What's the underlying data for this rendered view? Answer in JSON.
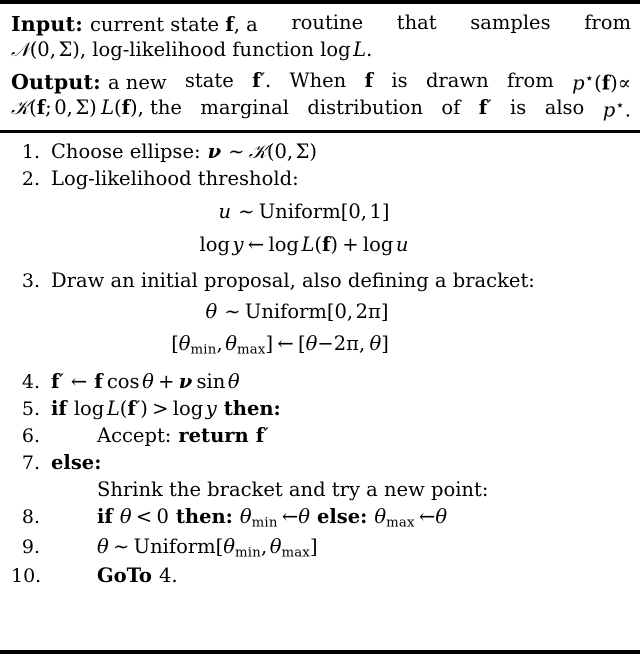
{
  "algorithm": {
    "header": {
      "input": {
        "label": "Input:",
        "line1_rest": "current state ",
        "f": "f",
        "line1_tail": ", a routine that samples from",
        "line2_a": "(0, ",
        "sigma": "Σ",
        "line2_b": "), log-likelihood function ",
        "log": "log",
        "L": "L",
        "period": "."
      },
      "output": {
        "label": "Output:",
        "t1": "a new state ",
        "fprime": "f′",
        "t2": ". When ",
        "f": "f",
        "t3": " is drawn from ",
        "p": "p",
        "star": "⋆",
        "propto": "∝",
        "t4": "(f; 0, Σ) L(f), the marginal distribution of ",
        "t5": " is also ",
        "t6": "."
      }
    },
    "steps": [
      {
        "num": "1.",
        "text": "Choose ellipse:",
        "math": "ν ∼ 𝒩(0, Σ)",
        "kind": "choose-ellipse"
      },
      {
        "num": "2.",
        "text": "Log-likelihood threshold:",
        "kind": "log-likelihood-threshold"
      },
      {
        "num": "",
        "equation": "u ∼ Uniform[0, 1]",
        "kind": "equation-u"
      },
      {
        "num": "",
        "equation": "log y ← log L(f) + log u",
        "kind": "equation-log-y"
      },
      {
        "num": "3.",
        "text": "Draw an initial proposal, also defining a bracket:",
        "kind": "draw-initial-proposal"
      },
      {
        "num": "",
        "equation": "θ ∼ Uniform[0, 2π]",
        "kind": "equation-theta"
      },
      {
        "num": "",
        "equation": "[θmin, θmax] ← [θ−2π, θ]",
        "kind": "equation-bracket"
      },
      {
        "num": "4.",
        "math": "f′ ← f cos θ + ν sin θ",
        "kind": "rotate-proposal"
      },
      {
        "num": "5.",
        "math": "if log L(f′) > log y then:",
        "kind": "if-accept-test"
      },
      {
        "num": "6.",
        "math": "Accept: return f′",
        "kind": "accept-return"
      },
      {
        "num": "7.",
        "math": "else:",
        "kind": "else-branch"
      },
      {
        "num": "",
        "text": "Shrink the bracket and try a new point:",
        "kind": "shrink-bracket-comment"
      },
      {
        "num": "8.",
        "math": "if θ < 0 then: θmin ← θ else: θmax ← θ",
        "kind": "shrink-bracket-update"
      },
      {
        "num": "9.",
        "math": "θ ∼ Uniform[θmin, θmax]",
        "kind": "resample-theta"
      },
      {
        "num": "10.",
        "math": "GoTo 4.",
        "kind": "goto-step-4"
      }
    ],
    "symbols": {
      "cal_N": "𝒩",
      "sigma": "Σ",
      "nu": "ν",
      "theta": "θ",
      "pi": "π",
      "sim": "∼",
      "gets": "←",
      "propto": "∝",
      "star": "⋆",
      "minus": "−",
      "gt": ">",
      "lt": "<",
      "plus": "+",
      "uniform": "Uniform",
      "log": "log",
      "cos": "cos",
      "sin": "sin",
      "min": "min",
      "max": "max",
      "kw_if": "if",
      "kw_then": "then:",
      "kw_else": "else:",
      "kw_return": "return",
      "kw_goto": "GoTo",
      "accept": "Accept:",
      "four": "4.",
      "zero": "0",
      "one": "1",
      "two": "2"
    },
    "colors": {
      "text": "#000000",
      "background": "#ffffff",
      "rule": "#000000"
    }
  }
}
